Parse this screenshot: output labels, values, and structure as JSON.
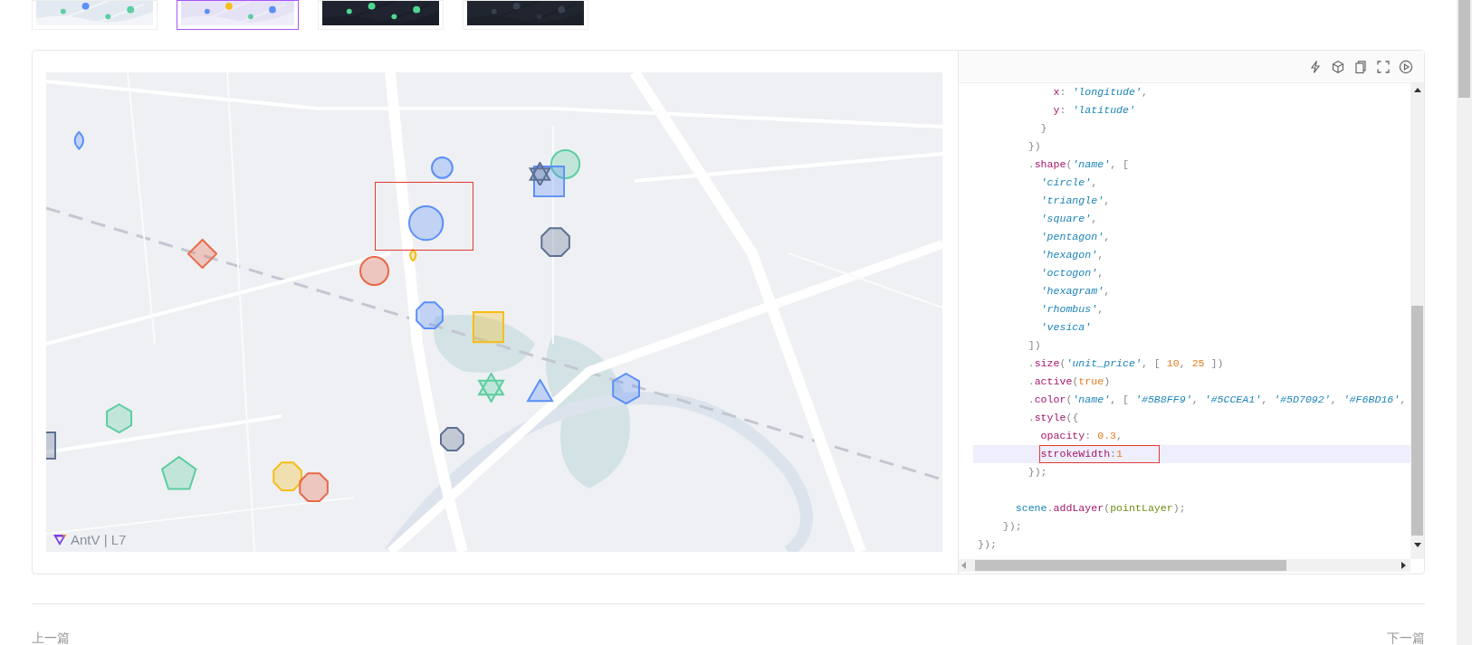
{
  "thumbnails": [
    {
      "kind": "picture",
      "selected": false
    },
    {
      "kind": "picture",
      "selected": true
    },
    {
      "kind": "picture",
      "selected": false
    },
    {
      "kind": "picture",
      "selected": false
    }
  ],
  "map": {
    "logo": "AntV | L7",
    "markers": [
      {
        "kind": "vesica",
        "color": "#5b8ff9"
      },
      {
        "kind": "circle",
        "color": "#5b8ff9"
      },
      {
        "kind": "circle",
        "color": "#5ccea1"
      },
      {
        "kind": "square",
        "color": "#5b8ff9"
      },
      {
        "kind": "hexagram",
        "color": "#5d7092"
      },
      {
        "kind": "circle",
        "color": "#5b8ff9"
      },
      {
        "kind": "octagon",
        "color": "#5d7092"
      },
      {
        "kind": "rhombus",
        "color": "#e8684a"
      },
      {
        "kind": "circle",
        "color": "#e8684a"
      },
      {
        "kind": "vesica",
        "color": "#f6bd16"
      },
      {
        "kind": "octagon",
        "color": "#5b8ff9"
      },
      {
        "kind": "square",
        "color": "#f6bd16"
      },
      {
        "kind": "hexagram",
        "color": "#5ccea1"
      },
      {
        "kind": "triangle",
        "color": "#5b8ff9"
      },
      {
        "kind": "hexagon",
        "color": "#5b8ff9"
      },
      {
        "kind": "hexagon",
        "color": "#5ccea1"
      },
      {
        "kind": "square",
        "color": "#5d7092"
      },
      {
        "kind": "octagon",
        "color": "#5d7092"
      },
      {
        "kind": "pentagon",
        "color": "#5ccea1"
      },
      {
        "kind": "octagon",
        "color": "#f6bd16"
      },
      {
        "kind": "octagon",
        "color": "#e8684a"
      }
    ]
  },
  "code_lines": [
    {
      "highlighted": false,
      "annotated": false,
      "tokens": [
        {
          "kind": "prop",
          "text": "            x"
        },
        {
          "kind": "punc",
          "text": ": "
        },
        {
          "kind": "str",
          "text": "'longitude'"
        },
        {
          "kind": "punc",
          "text": ","
        }
      ]
    },
    {
      "highlighted": false,
      "annotated": false,
      "tokens": [
        {
          "kind": "prop",
          "text": "            y"
        },
        {
          "kind": "punc",
          "text": ": "
        },
        {
          "kind": "str",
          "text": "'latitude'"
        }
      ]
    },
    {
      "highlighted": false,
      "annotated": false,
      "tokens": [
        {
          "kind": "punc",
          "text": "          }"
        }
      ]
    },
    {
      "highlighted": false,
      "annotated": false,
      "tokens": [
        {
          "kind": "punc",
          "text": "        })"
        }
      ]
    },
    {
      "highlighted": false,
      "annotated": false,
      "tokens": [
        {
          "kind": "punc",
          "text": "        ."
        },
        {
          "kind": "prop",
          "text": "shape"
        },
        {
          "kind": "punc",
          "text": "("
        },
        {
          "kind": "str",
          "text": "'name'"
        },
        {
          "kind": "punc",
          "text": ", ["
        }
      ]
    },
    {
      "highlighted": false,
      "annotated": false,
      "tokens": [
        {
          "kind": "str",
          "text": "          'circle'"
        },
        {
          "kind": "punc",
          "text": ","
        }
      ]
    },
    {
      "highlighted": false,
      "annotated": false,
      "tokens": [
        {
          "kind": "str",
          "text": "          'triangle'"
        },
        {
          "kind": "punc",
          "text": ","
        }
      ]
    },
    {
      "highlighted": false,
      "annotated": false,
      "tokens": [
        {
          "kind": "str",
          "text": "          'square'"
        },
        {
          "kind": "punc",
          "text": ","
        }
      ]
    },
    {
      "highlighted": false,
      "annotated": false,
      "tokens": [
        {
          "kind": "str",
          "text": "          'pentagon'"
        },
        {
          "kind": "punc",
          "text": ","
        }
      ]
    },
    {
      "highlighted": false,
      "annotated": false,
      "tokens": [
        {
          "kind": "str",
          "text": "          'hexagon'"
        },
        {
          "kind": "punc",
          "text": ","
        }
      ]
    },
    {
      "highlighted": false,
      "annotated": false,
      "tokens": [
        {
          "kind": "str",
          "text": "          'octogon'"
        },
        {
          "kind": "punc",
          "text": ","
        }
      ]
    },
    {
      "highlighted": false,
      "annotated": false,
      "tokens": [
        {
          "kind": "str",
          "text": "          'hexagram'"
        },
        {
          "kind": "punc",
          "text": ","
        }
      ]
    },
    {
      "highlighted": false,
      "annotated": false,
      "tokens": [
        {
          "kind": "str",
          "text": "          'rhombus'"
        },
        {
          "kind": "punc",
          "text": ","
        }
      ]
    },
    {
      "highlighted": false,
      "annotated": false,
      "tokens": [
        {
          "kind": "str",
          "text": "          'vesica'"
        }
      ]
    },
    {
      "highlighted": false,
      "annotated": false,
      "tokens": [
        {
          "kind": "punc",
          "text": "        ])"
        }
      ]
    },
    {
      "highlighted": false,
      "annotated": false,
      "tokens": [
        {
          "kind": "punc",
          "text": "        ."
        },
        {
          "kind": "prop",
          "text": "size"
        },
        {
          "kind": "punc",
          "text": "("
        },
        {
          "kind": "str",
          "text": "'unit_price'"
        },
        {
          "kind": "punc",
          "text": ", [ "
        },
        {
          "kind": "num",
          "text": "10"
        },
        {
          "kind": "punc",
          "text": ", "
        },
        {
          "kind": "num",
          "text": "25"
        },
        {
          "kind": "punc",
          "text": " ])"
        }
      ]
    },
    {
      "highlighted": false,
      "annotated": false,
      "tokens": [
        {
          "kind": "punc",
          "text": "        ."
        },
        {
          "kind": "prop",
          "text": "active"
        },
        {
          "kind": "punc",
          "text": "("
        },
        {
          "kind": "num",
          "text": "true"
        },
        {
          "kind": "punc",
          "text": ")"
        }
      ]
    },
    {
      "highlighted": false,
      "annotated": false,
      "tokens": [
        {
          "kind": "punc",
          "text": "        ."
        },
        {
          "kind": "prop",
          "text": "color"
        },
        {
          "kind": "punc",
          "text": "("
        },
        {
          "kind": "str",
          "text": "'name'"
        },
        {
          "kind": "punc",
          "text": ", [ "
        },
        {
          "kind": "str",
          "text": "'#5B8FF9'"
        },
        {
          "kind": "punc",
          "text": ", "
        },
        {
          "kind": "str",
          "text": "'#5CCEA1'"
        },
        {
          "kind": "punc",
          "text": ", "
        },
        {
          "kind": "str",
          "text": "'#5D7092'"
        },
        {
          "kind": "punc",
          "text": ", "
        },
        {
          "kind": "str",
          "text": "'#F6BD16'"
        },
        {
          "kind": "punc",
          "text": ","
        }
      ]
    },
    {
      "highlighted": false,
      "annotated": false,
      "tokens": [
        {
          "kind": "punc",
          "text": "        ."
        },
        {
          "kind": "prop",
          "text": "style"
        },
        {
          "kind": "punc",
          "text": "({"
        }
      ]
    },
    {
      "highlighted": false,
      "annotated": false,
      "tokens": [
        {
          "kind": "prop",
          "text": "          opacity"
        },
        {
          "kind": "punc",
          "text": ": "
        },
        {
          "kind": "num",
          "text": "0.3"
        },
        {
          "kind": "punc",
          "text": ","
        }
      ]
    },
    {
      "highlighted": true,
      "annotated": true,
      "tokens": [
        {
          "kind": "prop",
          "text": "          strokeWidth"
        },
        {
          "kind": "punc",
          "text": ":"
        },
        {
          "kind": "num",
          "text": "1"
        }
      ]
    },
    {
      "highlighted": false,
      "annotated": false,
      "tokens": [
        {
          "kind": "punc",
          "text": "        });"
        }
      ]
    },
    {
      "highlighted": false,
      "annotated": false
    },
    {
      "highlighted": false,
      "annotated": false,
      "tokens": [
        {
          "kind": "var",
          "text": "      scene"
        },
        {
          "kind": "punc",
          "text": "."
        },
        {
          "kind": "prop",
          "text": "addLayer"
        },
        {
          "kind": "punc",
          "text": "("
        },
        {
          "kind": "fn",
          "text": "pointLayer"
        },
        {
          "kind": "punc",
          "text": ");"
        }
      ]
    },
    {
      "highlighted": false,
      "annotated": false,
      "tokens": [
        {
          "kind": "punc",
          "text": "    });"
        }
      ]
    },
    {
      "highlighted": false,
      "annotated": false,
      "tokens": [
        {
          "kind": "punc",
          "text": "});"
        }
      ]
    }
  ],
  "pager": {
    "previous": "上一篇",
    "next": "下一篇"
  }
}
